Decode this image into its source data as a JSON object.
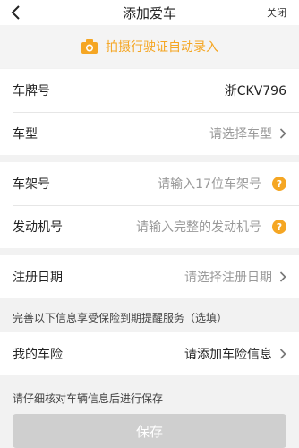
{
  "nav": {
    "title": "添加爱车",
    "close_label": "关闭"
  },
  "scan": {
    "label": "拍摄行驶证自动录入",
    "icon": "camera-icon"
  },
  "form": {
    "plate": {
      "label": "车牌号",
      "value": "浙CKV796"
    },
    "model": {
      "label": "车型",
      "placeholder": "请选择车型"
    },
    "vin": {
      "label": "车架号",
      "placeholder": "请输入17位车架号"
    },
    "engine": {
      "label": "发动机号",
      "placeholder": "请输入完整的发动机号"
    },
    "reg_date": {
      "label": "注册日期",
      "placeholder": "请选择注册日期"
    },
    "insurance_hint": "完善以下信息享受保险到期提醒服务（选填）",
    "insurance": {
      "label": "我的车险",
      "value": "请添加车险信息"
    }
  },
  "footer": {
    "notice": "请仔细核对车辆信息后进行保存",
    "save_label": "保存"
  },
  "colors": {
    "accent": "#f5a623",
    "help_icon": "#f5a623",
    "disabled_button": "#cfcfcf"
  }
}
